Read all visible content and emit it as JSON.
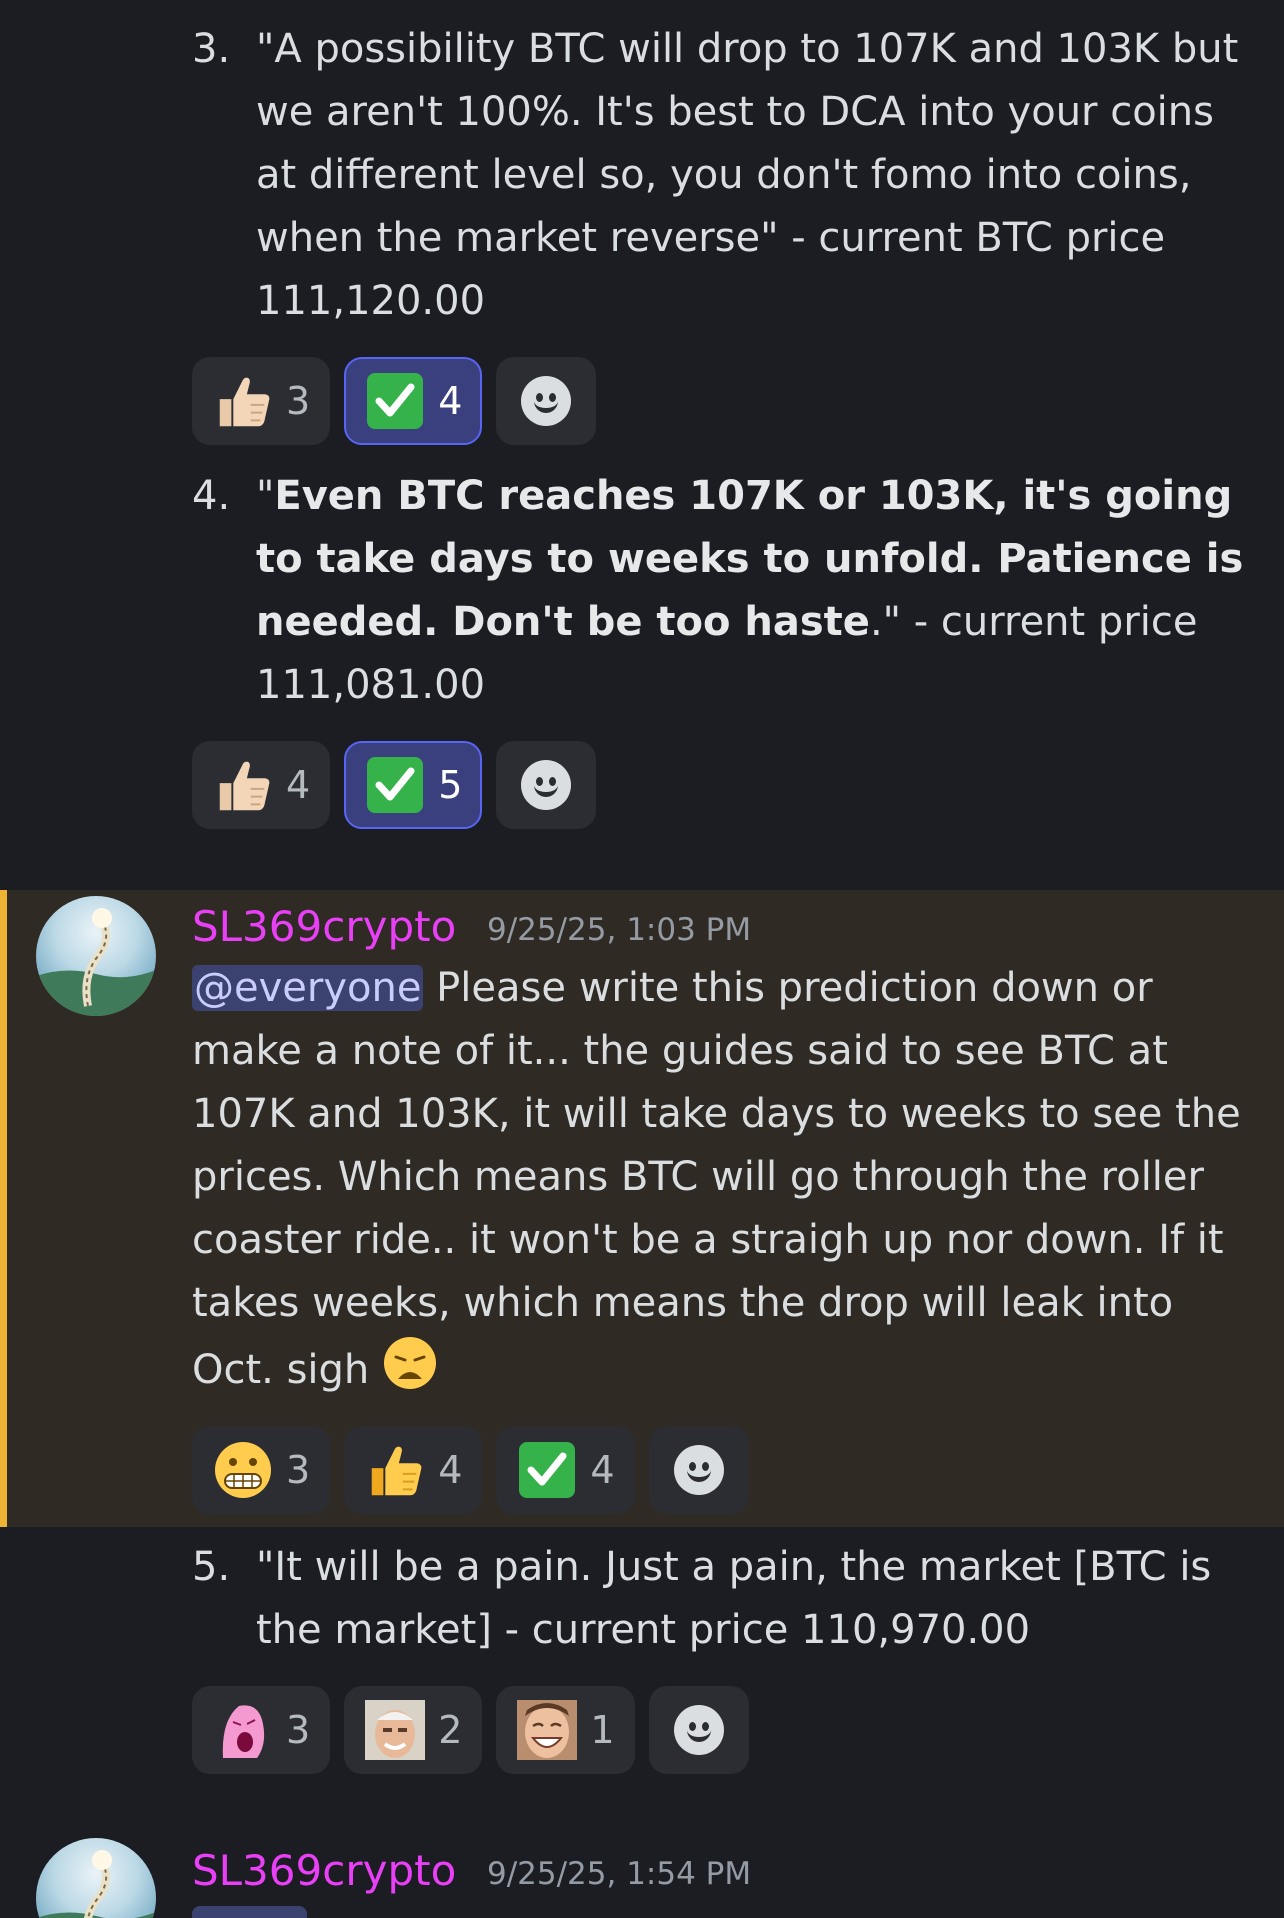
{
  "items": [
    {
      "number": "3.",
      "text": "\"A possibility BTC will drop to 107K and 103K but we aren't 100%. It's best to DCA into your coins at different level so, you don't fomo into coins, when the market reverse\" - current BTC price 111,120.00",
      "reactions": [
        {
          "emoji": "thumbs-up-light-icon",
          "count": "3",
          "me": false
        },
        {
          "emoji": "check-mark-icon",
          "count": "4",
          "me": true
        }
      ]
    },
    {
      "number": "4.",
      "text_bold": "Even BTC reaches 107K or 103K, it's going to take days to weeks to unfold. Patience is needed. Don't be too haste",
      "text_prefix": "\"",
      "text_suffix": ".\" - current price 111,081.00",
      "reactions": [
        {
          "emoji": "thumbs-up-light-icon",
          "count": "4",
          "me": false
        },
        {
          "emoji": "check-mark-icon",
          "count": "5",
          "me": true
        }
      ]
    },
    {
      "number": "5.",
      "text": "\"It will be a pain. Just a pain, the market [BTC is the market] - current price 110,970.00",
      "reactions": [
        {
          "emoji": "pink-wojak-screaming-icon",
          "count": "3"
        },
        {
          "emoji": "harold-face-icon",
          "count": "2"
        },
        {
          "emoji": "laughing-man-face-icon",
          "count": "1"
        }
      ]
    }
  ],
  "message1": {
    "username": "SL369crypto",
    "timestamp": "9/25/25, 1:03 PM",
    "mention": "@everyone",
    "text": " Please write this prediction down or make a note of it... the guides said to see BTC at 107K and 103K, it will take days to weeks to see the prices. Which means BTC will go through the roller coaster ride.. it won't be a straigh up nor down.  If it takes weeks, which means the drop will leak into Oct. sigh ",
    "inline_emoji": "weary-face-icon",
    "reactions": [
      {
        "emoji": "grimacing-face-icon",
        "count": "3"
      },
      {
        "emoji": "thumbs-up-yellow-icon",
        "count": "4"
      },
      {
        "emoji": "check-mark-icon",
        "count": "4"
      }
    ]
  },
  "message2": {
    "username": "SL369crypto",
    "timestamp": "9/25/25, 1:54 PM"
  },
  "colors": {
    "background": "#1c1d23",
    "highlight": "#2f2b24",
    "highlight_bar": "#f0b232",
    "username": "#e93ff6",
    "reaction_me": "#3a3f7e"
  }
}
